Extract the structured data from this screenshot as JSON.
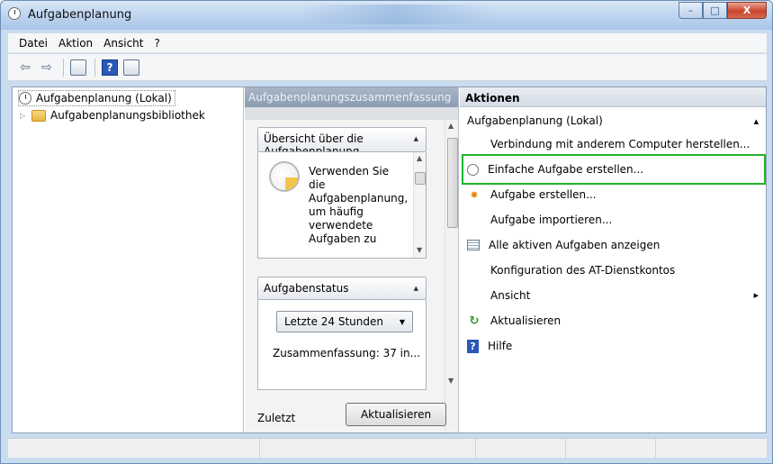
{
  "window": {
    "title": "Aufgabenplanung",
    "controls": {
      "minimize": "–",
      "maximize": "□",
      "close": "X"
    }
  },
  "menu": {
    "items": [
      "Datei",
      "Aktion",
      "Ansicht",
      "?"
    ]
  },
  "toolbar": {
    "back_icon": "⇦",
    "forward_icon": "⇨",
    "help_icon": "?"
  },
  "tree": {
    "root": "Aufgabenplanung (Lokal)",
    "child": "Aufgabenplanungsbibliothek"
  },
  "middle": {
    "header": "Aufgabenplanungszusammenfassung",
    "overview_title": "Übersicht über die Aufgabenplanung",
    "overview_text": "Verwenden Sie die Aufgabenplanung, um häufig verwendete Aufgaben zu",
    "status_title": "Aufgabenstatus",
    "status_select": "Letzte 24 Stunden",
    "summary": "Zusammenfassung: 37 in...",
    "last_label": "Zuletzt",
    "refresh_button": "Aktualisieren"
  },
  "actions": {
    "header": "Aktionen",
    "group": "Aufgabenplanung (Lokal)",
    "items": [
      {
        "label": "Verbindung mit anderem Computer herstellen...",
        "icon": "none"
      },
      {
        "label": "Einfache Aufgabe erstellen...",
        "icon": "clock-icon"
      },
      {
        "label": "Aufgabe erstellen...",
        "icon": "new-task-icon"
      },
      {
        "label": "Aufgabe importieren...",
        "icon": "none"
      },
      {
        "label": "Alle aktiven Aufgaben anzeigen",
        "icon": "list-icon"
      },
      {
        "label": "Konfiguration des AT-Dienstkontos",
        "icon": "none"
      },
      {
        "label": "Ansicht",
        "icon": "none",
        "submenu": true
      },
      {
        "label": "Aktualisieren",
        "icon": "refresh-icon"
      },
      {
        "label": "Hilfe",
        "icon": "help-icon"
      }
    ],
    "highlight_color": "#22b22a"
  }
}
